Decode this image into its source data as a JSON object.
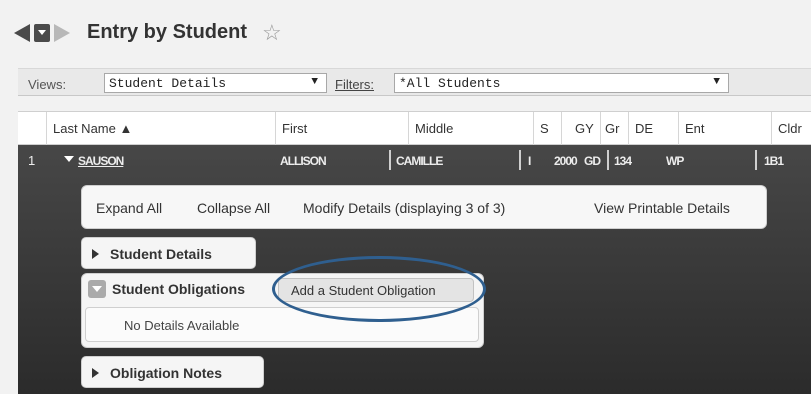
{
  "header": {
    "title": "Entry by Student",
    "icons": {
      "back": "triangle-left-icon",
      "list": "list-dropdown-icon",
      "forward": "triangle-right-icon",
      "favorite": "star-outline-icon"
    }
  },
  "toolbar": {
    "views_label": "Views:",
    "views_value": "Student Details",
    "filters_label": "Filters:",
    "filters_value": "*All Students",
    "dropdown_glyph": "▼"
  },
  "table": {
    "columns": [
      "Last Name ▲",
      "First",
      "Middle",
      "S",
      "GY",
      "Gr",
      "DE",
      "Ent",
      "Cldr"
    ],
    "row": {
      "number": "1",
      "cells": [
        "SAUSON",
        "ALLISON",
        "CAMILLE",
        "I",
        "2000",
        "GD",
        "134",
        "WP",
        "1B1"
      ]
    }
  },
  "actions": {
    "expand_all": "Expand All",
    "collapse_all": "Collapse All",
    "modify_details": "Modify Details (displaying 3 of 3)",
    "view_printable": "View Printable Details"
  },
  "sections": {
    "student_details": "Student Details",
    "student_obligations": "Student Obligations",
    "add_obligation": "Add a Student Obligation",
    "no_details": "No Details Available",
    "obligation_notes": "Obligation Notes"
  },
  "colors": {
    "highlight": "#2f5f8f",
    "row_dark": "#3a3a3a",
    "panel": "#f5f5f5"
  }
}
